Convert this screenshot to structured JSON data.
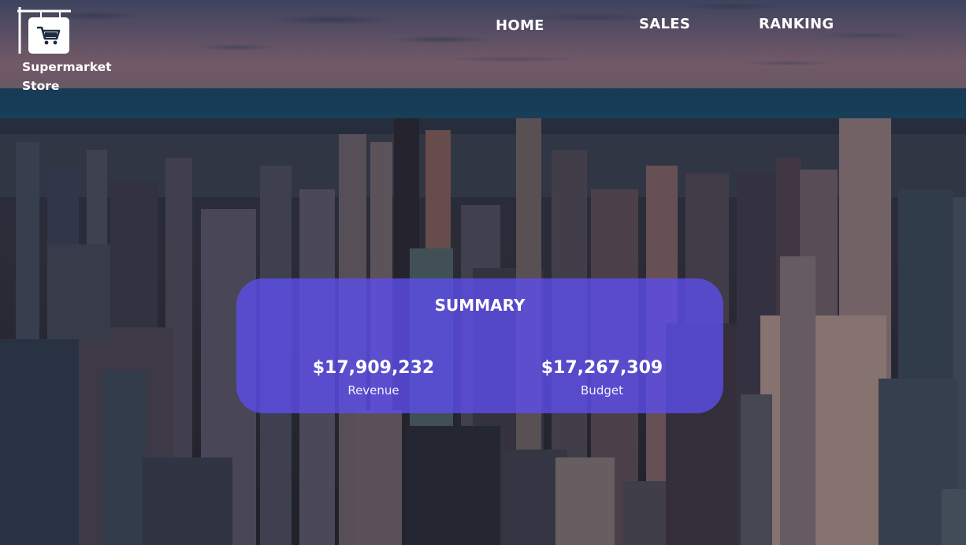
{
  "brand": {
    "name": "Supermarket Store",
    "icon": "shopping-cart-icon"
  },
  "nav": {
    "items": [
      {
        "label": "HOME"
      },
      {
        "label": "SALES"
      },
      {
        "label": "RANKING"
      }
    ]
  },
  "summary": {
    "title": "SUMMARY",
    "metrics": [
      {
        "value": "$17,909,232",
        "label": "Revenue"
      },
      {
        "value": "$17,267,309",
        "label": "Budget"
      }
    ]
  },
  "colors": {
    "card_background": "#5c4eeb",
    "text": "#ffffff"
  }
}
